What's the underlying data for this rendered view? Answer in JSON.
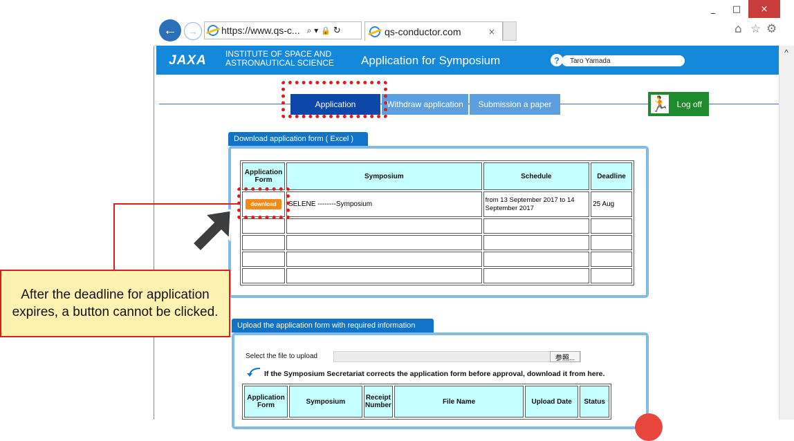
{
  "browser": {
    "url": "https://www.qs-c...",
    "tab_title": "qs-conductor.com",
    "tab_close": "×",
    "minimize": "_",
    "maximize": "□",
    "close": "×",
    "back": "←",
    "forward": "→",
    "search_glyph": "⌕ ▾",
    "lock_glyph": "🔒",
    "refresh_glyph": "↻",
    "home_glyph": "⌂",
    "star_glyph": "☆",
    "gear_glyph": "⚙",
    "scroll_up_glyph": "^"
  },
  "header": {
    "logo_text": "JAXA",
    "institute_line1": "INSTITUTE OF SPACE AND",
    "institute_line2": "ASTRONAUTICAL SCIENCE",
    "title": "Application for Symposium",
    "help_glyph": "?",
    "user_name": "Taro Yamada"
  },
  "nav": {
    "application": "Application",
    "withdraw": "Withdraw application",
    "submission": "Submission a paper",
    "logoff": "Log off",
    "exit_glyph": "🏃"
  },
  "download_panel": {
    "tab_label": "Download application form ( Excel )",
    "columns": [
      "Application Form",
      "Symposium",
      "Schedule",
      "Deadline"
    ],
    "rows": [
      {
        "button": "download",
        "symposium": "SELENE --------Symposium",
        "schedule": "from 13 September 2017 to 14 September 2017",
        "deadline": "25 Aug"
      }
    ]
  },
  "callout": {
    "text": "After the deadline for application expires, a button cannot be clicked."
  },
  "upload_panel": {
    "tab_label": "Upload the application form with required information",
    "select_label": "Select the file to upload",
    "browse_button": "参照...",
    "note": "If the Symposium Secretariat corrects the application form before approval, download it from here.",
    "columns": [
      "Application Form",
      "Symposium",
      "Receipt Number",
      "File Name",
      "Upload Date",
      "Status"
    ]
  },
  "colors": {
    "header_blue": "#1489dc",
    "nav_active": "#0d47a8",
    "highlight_red": "#dd1c1c",
    "callout_fill": "#fff2b0",
    "table_header": "#c6ffff",
    "download_orange": "#f28b16"
  }
}
